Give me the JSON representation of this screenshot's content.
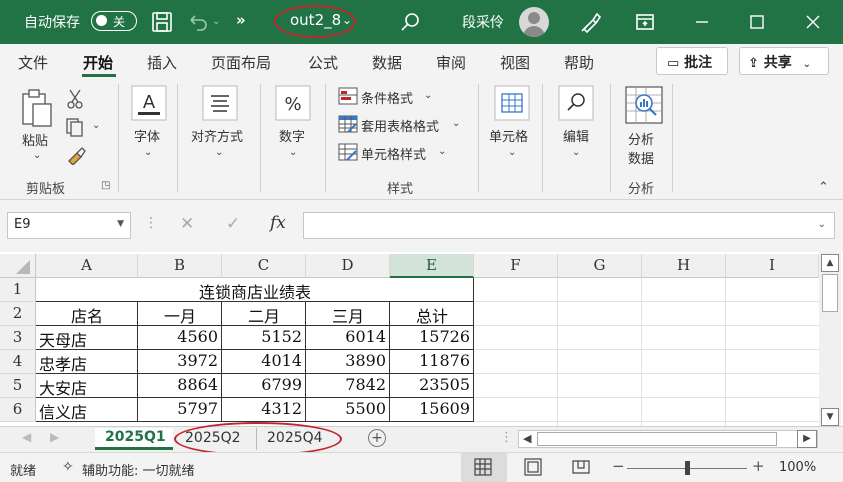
{
  "titlebar": {
    "autosave_label": "自动保存",
    "autosave_state": "关",
    "more": "»",
    "filename": "out2_8",
    "user": "段采伶"
  },
  "menu": {
    "tabs": [
      "文件",
      "开始",
      "插入",
      "页面布局",
      "公式",
      "数据",
      "审阅",
      "视图",
      "帮助"
    ],
    "active_tab": "开始",
    "comment_label": "批注",
    "share_label": "共享"
  },
  "ribbon": {
    "paste": "粘贴",
    "clipboard_group": "剪贴板",
    "font": "字体",
    "align": "对齐方式",
    "number": "数字",
    "cond_format": "条件格式",
    "table_format": "套用表格格式",
    "cell_style": "单元格样式",
    "styles_group": "样式",
    "cells": "单元格",
    "edit": "编辑",
    "analyze_line1": "分析",
    "analyze_line2": "数据",
    "analyze_group": "分析"
  },
  "formula": {
    "namebox": "E9",
    "fx": "fx",
    "content": ""
  },
  "columns": [
    "A",
    "B",
    "C",
    "D",
    "E",
    "F",
    "G",
    "H",
    "I"
  ],
  "selected_column": "E",
  "rows": [
    "1",
    "2",
    "3",
    "4",
    "5",
    "6"
  ],
  "sheet": {
    "title": "连锁商店业绩表",
    "headers": [
      "店名",
      "一月",
      "二月",
      "三月",
      "总计"
    ],
    "data": [
      [
        "天母店",
        "4560",
        "5152",
        "6014",
        "15726"
      ],
      [
        "忠孝店",
        "3972",
        "4014",
        "3890",
        "11876"
      ],
      [
        "大安店",
        "8864",
        "6799",
        "7842",
        "23505"
      ],
      [
        "信义店",
        "5797",
        "4312",
        "5500",
        "15609"
      ]
    ]
  },
  "sheet_tabs": [
    "2025Q1",
    "2025Q2",
    "2025Q4"
  ],
  "active_sheet": "2025Q1",
  "statusbar": {
    "ready": "就绪",
    "accessibility": "辅助功能: 一切就绪",
    "zoom": "100%"
  },
  "colors": {
    "accent": "#217346",
    "annotation": "#c0262d"
  }
}
